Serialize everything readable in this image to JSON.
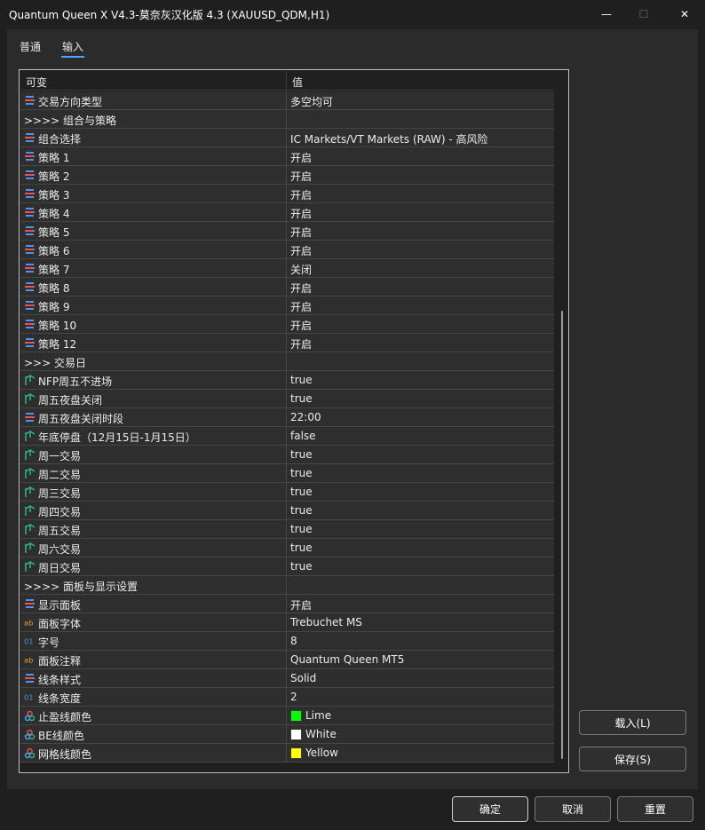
{
  "window": {
    "title": "Quantum Queen X V4.3-莫奈灰汉化版 4.3 (XAUUSD_QDM,H1)",
    "minimize_glyph": "—",
    "maximize_glyph": "☐",
    "close_glyph": "✕"
  },
  "tabs": [
    {
      "label": "普通"
    },
    {
      "label": "输入"
    }
  ],
  "table": {
    "col_name": "可变",
    "col_value": "值",
    "rows": [
      {
        "icon": "enum-icon",
        "name": "交易方向类型",
        "value": "多空均可"
      },
      {
        "icon": "",
        "name": ">>>> 组合与策略",
        "value": ""
      },
      {
        "icon": "enum-icon",
        "name": "组合选择",
        "value": "IC Markets/VT Markets (RAW) - 高风险"
      },
      {
        "icon": "enum-icon",
        "name": "策略 1",
        "value": "开启"
      },
      {
        "icon": "enum-icon",
        "name": "策略 2",
        "value": "开启"
      },
      {
        "icon": "enum-icon",
        "name": "策略 3",
        "value": "开启"
      },
      {
        "icon": "enum-icon",
        "name": "策略 4",
        "value": "开启"
      },
      {
        "icon": "enum-icon",
        "name": "策略 5",
        "value": "开启"
      },
      {
        "icon": "enum-icon",
        "name": "策略 6",
        "value": "开启"
      },
      {
        "icon": "enum-icon",
        "name": "策略 7",
        "value": "关闭"
      },
      {
        "icon": "enum-icon",
        "name": "策略 8",
        "value": "开启"
      },
      {
        "icon": "enum-icon",
        "name": "策略 9",
        "value": "开启"
      },
      {
        "icon": "enum-icon",
        "name": "策略 10",
        "value": "开启"
      },
      {
        "icon": "enum-icon",
        "name": "策略 12",
        "value": "开启"
      },
      {
        "icon": "",
        "name": ">>> 交易日",
        "value": ""
      },
      {
        "icon": "bool-icon",
        "name": "NFP周五不进场",
        "value": "true"
      },
      {
        "icon": "bool-icon",
        "name": "周五夜盘关闭",
        "value": "true"
      },
      {
        "icon": "enum-icon",
        "name": "周五夜盘关闭时段",
        "value": "22:00"
      },
      {
        "icon": "bool-icon",
        "name": "年底停盘（12月15日-1月15日）",
        "value": "false"
      },
      {
        "icon": "bool-icon",
        "name": "周一交易",
        "value": "true"
      },
      {
        "icon": "bool-icon",
        "name": "周二交易",
        "value": "true"
      },
      {
        "icon": "bool-icon",
        "name": "周三交易",
        "value": "true"
      },
      {
        "icon": "bool-icon",
        "name": "周四交易",
        "value": "true"
      },
      {
        "icon": "bool-icon",
        "name": "周五交易",
        "value": "true"
      },
      {
        "icon": "bool-icon",
        "name": "周六交易",
        "value": "true"
      },
      {
        "icon": "bool-icon",
        "name": "周日交易",
        "value": "true"
      },
      {
        "icon": "",
        "name": ">>>> 面板与显示设置",
        "value": ""
      },
      {
        "icon": "enum-icon",
        "name": "显示面板",
        "value": "开启"
      },
      {
        "icon": "string-icon",
        "name": "面板字体",
        "value": "Trebuchet MS"
      },
      {
        "icon": "int-icon",
        "name": "字号",
        "value": "8"
      },
      {
        "icon": "string-icon",
        "name": "面板注释",
        "value": "Quantum Queen MT5"
      },
      {
        "icon": "enum-icon",
        "name": "线条样式",
        "value": "Solid"
      },
      {
        "icon": "int-icon",
        "name": "线条宽度",
        "value": "2"
      },
      {
        "icon": "color-icon",
        "name": "止盈线颜色",
        "value": "Lime",
        "swatch": "#00ff00"
      },
      {
        "icon": "color-icon",
        "name": "BE线颜色",
        "value": "White",
        "swatch": "#ffffff"
      },
      {
        "icon": "color-icon",
        "name": "网格线颜色",
        "value": "Yellow",
        "swatch": "#ffff00"
      }
    ]
  },
  "buttons": {
    "load": "载入(L)",
    "save": "保存(S)",
    "ok": "确定",
    "cancel": "取消",
    "reset": "重置"
  },
  "colors": {
    "accent": "#4da3ff",
    "enum_icon": "#5b8def",
    "bool_icon": "#2fb48a",
    "string_icon": "#e0a030",
    "int_icon": "#4a8fe0"
  }
}
